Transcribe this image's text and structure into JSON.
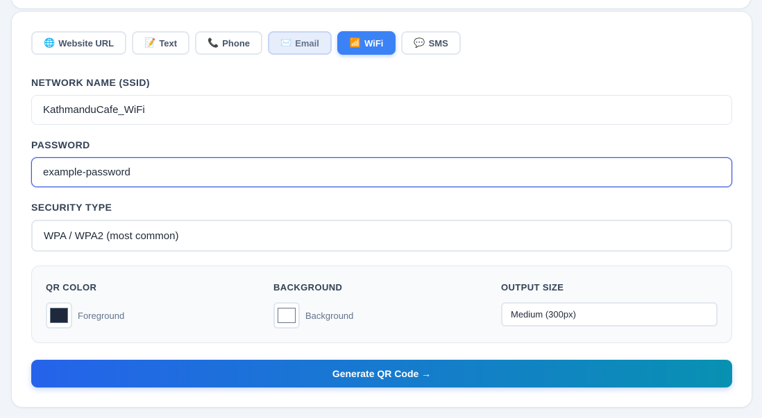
{
  "tabs": [
    {
      "icon": "🌐",
      "label": "Website URL"
    },
    {
      "icon": "📝",
      "label": "Text"
    },
    {
      "icon": "📞",
      "label": "Phone"
    },
    {
      "icon": "✉️",
      "label": "Email"
    },
    {
      "icon": "📶",
      "label": "WiFi"
    },
    {
      "icon": "💬",
      "label": "SMS"
    }
  ],
  "active_tab": "WiFi",
  "fields": {
    "ssid": {
      "label": "NETWORK NAME (SSID)",
      "value": "KathmanduCafe_WiFi"
    },
    "password": {
      "label": "PASSWORD",
      "value": "example-password"
    },
    "security": {
      "label": "SECURITY TYPE",
      "value": "WPA / WPA2 (most common)"
    }
  },
  "options": {
    "qr_color": {
      "label": "QR COLOR",
      "text": "Foreground",
      "color": "#1e293b"
    },
    "background": {
      "label": "BACKGROUND",
      "text": "Background",
      "color": "#ffffff"
    },
    "output_size": {
      "label": "OUTPUT SIZE",
      "value": "Medium (300px)"
    }
  },
  "generate_button": {
    "label": "Generate QR Code →"
  },
  "colors": {
    "accent": "#3b82f6",
    "gradient_start": "#2563eb",
    "gradient_end": "#0891b2"
  }
}
